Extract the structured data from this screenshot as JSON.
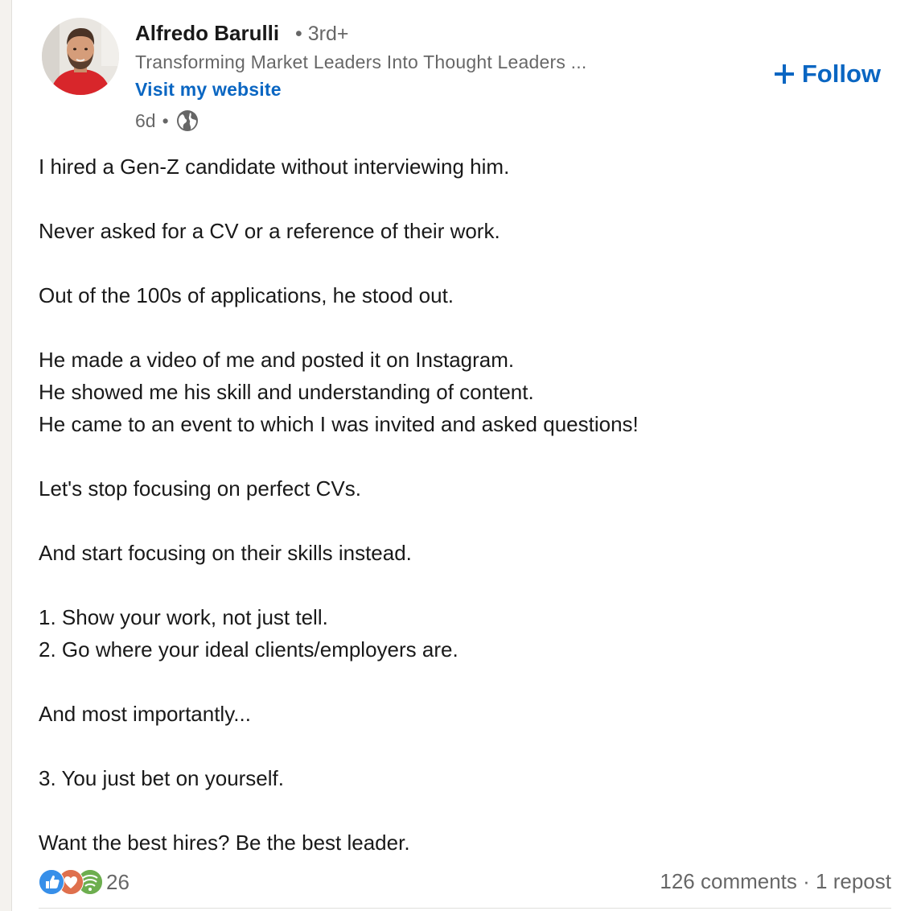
{
  "author": {
    "name": "Alfredo Barulli",
    "degree_separator": "•",
    "degree": "3rd+",
    "headline": "Transforming Market Leaders Into Thought Leaders ...",
    "website_label": "Visit my website",
    "time_ago": "6d",
    "meta_separator": "•",
    "visibility_icon": "globe-icon",
    "avatar_icon": "profile-photo"
  },
  "follow": {
    "icon": "plus-icon",
    "label": "Follow",
    "color": "#0a66c2"
  },
  "post": {
    "lines": [
      "I hired a Gen-Z candidate without interviewing him.",
      "",
      "Never asked for a CV or a reference of their work.",
      "",
      "Out of the 100s of applications, he stood out.",
      "",
      "He made a video of me and posted it on Instagram.",
      "He showed me his skill and understanding of content.",
      "He came to an event to which I was invited and asked questions!",
      "",
      "Let's stop focusing on perfect CVs.",
      "",
      "And start focusing on their skills instead.",
      "",
      "1. Show your work, not just tell.",
      "2. Go where your ideal clients/employers are.",
      "",
      "And most importantly...",
      "",
      "3. You just bet on yourself.",
      "",
      "Want the best hires? Be the best leader."
    ]
  },
  "social": {
    "reaction_icons": [
      "like-icon",
      "love-icon",
      "support-icon"
    ],
    "reaction_count": "26",
    "comments": "126 comments",
    "separator": "·",
    "reposts": "1 repost"
  }
}
